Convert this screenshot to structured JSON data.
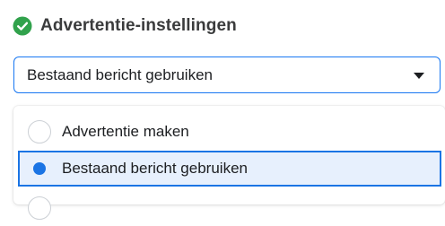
{
  "section": {
    "title": "Advertentie-instellingen",
    "status_icon": "check-circle-icon",
    "status_color": "#31a24c"
  },
  "dropdown": {
    "selected_value": "Bestaand bericht gebruiken",
    "caret_icon": "caret-down-icon",
    "focus_color": "#1877f2"
  },
  "menu": {
    "options": [
      {
        "label": "Advertentie maken",
        "selected": false
      },
      {
        "label": "Bestaand bericht gebruiken",
        "selected": true
      },
      {
        "label": "",
        "selected": false
      }
    ]
  }
}
